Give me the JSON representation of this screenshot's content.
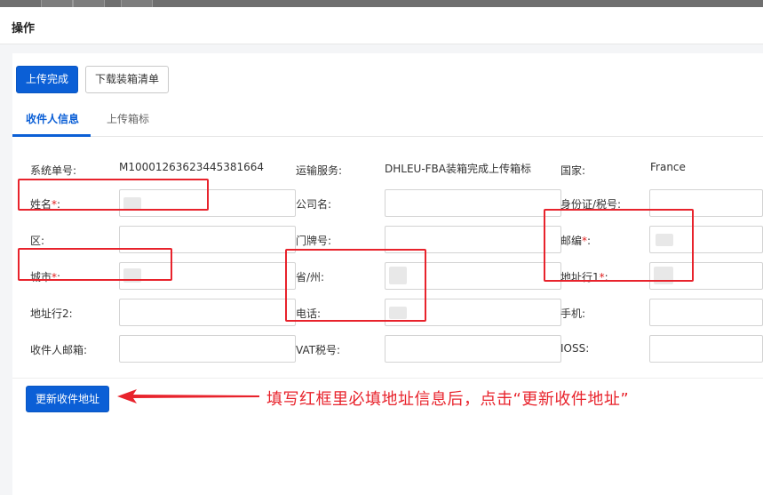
{
  "dialog": {
    "title": "操作"
  },
  "toolbar": {
    "upload_done": "上传完成",
    "download_list": "下载装箱清单"
  },
  "tabs": [
    {
      "label": "收件人信息",
      "active": true
    },
    {
      "label": "上传箱标",
      "active": false
    }
  ],
  "form": {
    "system_no": {
      "label": "系统单号:",
      "value": "M1000126362344538166​4"
    },
    "shipping_service": {
      "label": "运输服务:",
      "value": "DHLEU-FBA装箱完成上传箱标"
    },
    "country": {
      "label": "国家:",
      "value": "France"
    },
    "name": {
      "label": "姓名",
      "req": "*",
      "colon": ":"
    },
    "company": {
      "label": "公司名:"
    },
    "id_tax": {
      "label": "身份证/税号:"
    },
    "district": {
      "label": "区:"
    },
    "door_no": {
      "label": "门牌号:"
    },
    "postcode": {
      "label": "邮编",
      "req": "*",
      "colon": ":"
    },
    "city": {
      "label": "城市",
      "req": "*",
      "colon": ":"
    },
    "province": {
      "label": "省/州:"
    },
    "address1": {
      "label": "地址行1",
      "req": "*",
      "colon": ":"
    },
    "address2": {
      "label": "地址行2:"
    },
    "phone": {
      "label": "电话:"
    },
    "mobile": {
      "label": "手机:"
    },
    "email": {
      "label": "收件人邮箱:"
    },
    "vat": {
      "label": "VAT税号:"
    },
    "ioss": {
      "label": "IOSS:"
    }
  },
  "actions": {
    "update_address": "更新收件地址"
  },
  "annotation": {
    "text": "填写红框里必填地址信息后，点击“更新收件地址”"
  },
  "colors": {
    "primary": "#0b5fd6",
    "highlight_red": "#e8232c"
  }
}
